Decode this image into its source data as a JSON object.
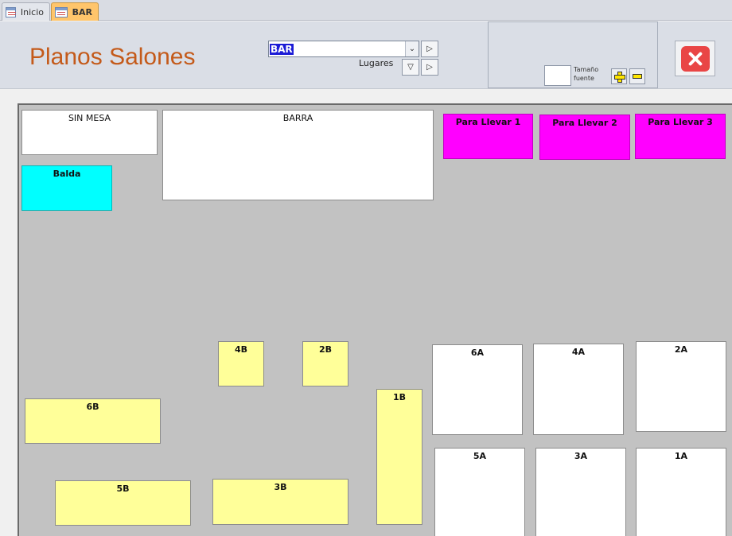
{
  "tabs": [
    {
      "label": "Inicio",
      "active": false
    },
    {
      "label": "BAR",
      "active": true
    }
  ],
  "header": {
    "title": "Planos Salones",
    "combo_value": "BAR",
    "lugares_label": "Lugares",
    "font_size_label": "Tamaño fuente",
    "title_color": "#c45a1a"
  },
  "floor": {
    "tables": [
      {
        "name": "SIN MESA",
        "color": "white"
      },
      {
        "name": "BARRA",
        "color": "white"
      },
      {
        "name": "Para Llevar 1",
        "color": "magenta"
      },
      {
        "name": "Para Llevar 2",
        "color": "magenta"
      },
      {
        "name": "Para Llevar 3",
        "color": "magenta"
      },
      {
        "name": "Balda",
        "color": "cyan"
      },
      {
        "name": "4B",
        "color": "yellow"
      },
      {
        "name": "2B",
        "color": "yellow"
      },
      {
        "name": "6A",
        "color": "white"
      },
      {
        "name": "4A",
        "color": "white"
      },
      {
        "name": "2A",
        "color": "white"
      },
      {
        "name": "6B",
        "color": "yellow"
      },
      {
        "name": "1B",
        "color": "yellow"
      },
      {
        "name": "5B",
        "color": "yellow"
      },
      {
        "name": "3B",
        "color": "yellow"
      },
      {
        "name": "5A",
        "color": "white"
      },
      {
        "name": "3A",
        "color": "white"
      },
      {
        "name": "1A",
        "color": "white"
      }
    ]
  }
}
